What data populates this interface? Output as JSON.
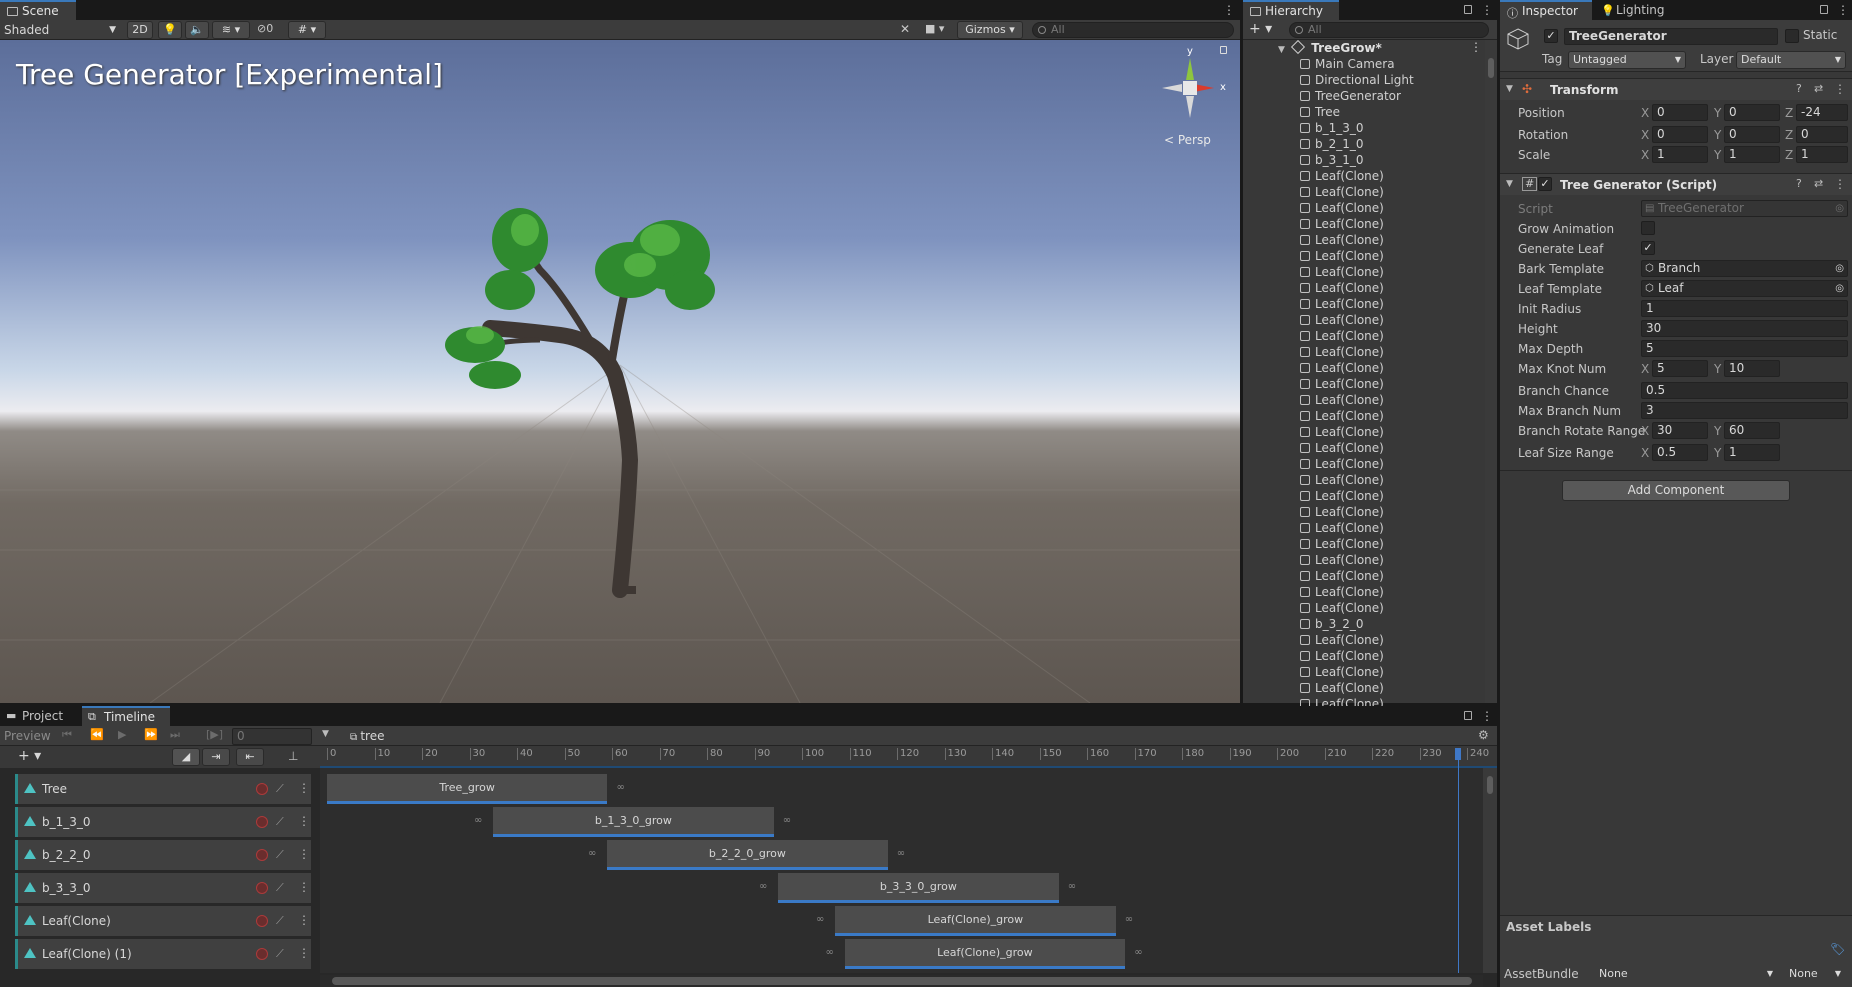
{
  "scene": {
    "tab": "Scene",
    "shading": "Shaded",
    "mode_2d": "2D",
    "hidden_count": "0",
    "gizmos": "Gizmos",
    "search_placeholder": "All",
    "title_overlay": "Tree Generator [Experimental]",
    "persp_label": "< Persp",
    "axis_y": "y",
    "axis_x": "x"
  },
  "hierarchy": {
    "tab": "Hierarchy",
    "search_placeholder": "All",
    "root": "TreeGrow*",
    "items": [
      "Main Camera",
      "Directional Light",
      "TreeGenerator",
      "Tree",
      "b_1_3_0",
      "b_2_1_0",
      "b_3_1_0",
      "Leaf(Clone)",
      "Leaf(Clone)",
      "Leaf(Clone)",
      "Leaf(Clone)",
      "Leaf(Clone)",
      "Leaf(Clone)",
      "Leaf(Clone)",
      "Leaf(Clone)",
      "Leaf(Clone)",
      "Leaf(Clone)",
      "Leaf(Clone)",
      "Leaf(Clone)",
      "Leaf(Clone)",
      "Leaf(Clone)",
      "Leaf(Clone)",
      "Leaf(Clone)",
      "Leaf(Clone)",
      "Leaf(Clone)",
      "Leaf(Clone)",
      "Leaf(Clone)",
      "Leaf(Clone)",
      "Leaf(Clone)",
      "Leaf(Clone)",
      "Leaf(Clone)",
      "Leaf(Clone)",
      "Leaf(Clone)",
      "Leaf(Clone)",
      "Leaf(Clone)",
      "b_3_2_0",
      "Leaf(Clone)",
      "Leaf(Clone)",
      "Leaf(Clone)",
      "Leaf(Clone)",
      "Leaf(Clone)",
      "Leaf(Clone)",
      "Leaf(Clone)",
      "Leaf(Clone)"
    ]
  },
  "inspector": {
    "tab": "Inspector",
    "tab2": "Lighting",
    "object_name": "TreeGenerator",
    "static_label": "Static",
    "tag_label": "Tag",
    "tag_value": "Untagged",
    "layer_label": "Layer",
    "layer_value": "Default",
    "transform": {
      "title": "Transform",
      "position_label": "Position",
      "position": {
        "x": "0",
        "y": "0",
        "z": "-24"
      },
      "rotation_label": "Rotation",
      "rotation": {
        "x": "0",
        "y": "0",
        "z": "0"
      },
      "scale_label": "Scale",
      "scale": {
        "x": "1",
        "y": "1",
        "z": "1"
      }
    },
    "script": {
      "title": "Tree Generator (Script)",
      "script_label": "Script",
      "script_value": "TreeGenerator",
      "grow_animation_label": "Grow Animation",
      "grow_animation": false,
      "generate_leaf_label": "Generate Leaf",
      "generate_leaf": true,
      "bark_template_label": "Bark Template",
      "bark_template": "Branch",
      "leaf_template_label": "Leaf Template",
      "leaf_template": "Leaf",
      "init_radius_label": "Init Radius",
      "init_radius": "1",
      "height_label": "Height",
      "height": "30",
      "max_depth_label": "Max Depth",
      "max_depth": "5",
      "max_knot_num_label": "Max Knot Num",
      "max_knot_num": {
        "x": "5",
        "y": "10"
      },
      "branch_chance_label": "Branch Chance",
      "branch_chance": "0.5",
      "max_branch_num_label": "Max Branch Num",
      "max_branch_num": "3",
      "branch_rotate_range_label": "Branch Rotate Range",
      "branch_rotate_range": {
        "x": "30",
        "y": "60"
      },
      "leaf_size_range_label": "Leaf Size Range",
      "leaf_size_range": {
        "x": "0.5",
        "y": "1"
      }
    },
    "add_component": "Add Component",
    "asset_labels": "Asset Labels",
    "asset_bundle_label": "AssetBundle",
    "asset_bundle_value": "None",
    "asset_bundle_variant": "None"
  },
  "timeline": {
    "tab_project": "Project",
    "tab_timeline": "Timeline",
    "preview": "Preview",
    "frame": "0",
    "asset_name": "tree",
    "ruler": [
      "0",
      "10",
      "20",
      "30",
      "40",
      "50",
      "60",
      "70",
      "80",
      "90",
      "100",
      "110",
      "120",
      "130",
      "140",
      "150",
      "160",
      "170",
      "180",
      "190",
      "200",
      "210",
      "220",
      "230",
      "240"
    ],
    "tracks": [
      {
        "name": "Tree",
        "clip": "Tree_grow"
      },
      {
        "name": "b_1_3_0",
        "clip": "b_1_3_0_grow"
      },
      {
        "name": "b_2_2_0",
        "clip": "b_2_2_0_grow"
      },
      {
        "name": "b_3_3_0",
        "clip": "b_3_3_0_grow"
      },
      {
        "name": "Leaf(Clone)",
        "clip": "Leaf(Clone)_grow"
      },
      {
        "name": "Leaf(Clone) (1)",
        "clip": "Leaf(Clone)_grow"
      }
    ],
    "clip_ranges": [
      [
        0,
        59
      ],
      [
        35,
        94
      ],
      [
        59,
        118
      ],
      [
        95,
        154
      ],
      [
        107,
        166
      ],
      [
        109,
        168
      ]
    ],
    "playhead": 238
  },
  "colors": {
    "accent": "#3a79bb",
    "track": "#4ec3c3",
    "record": "#ab3a3a"
  }
}
